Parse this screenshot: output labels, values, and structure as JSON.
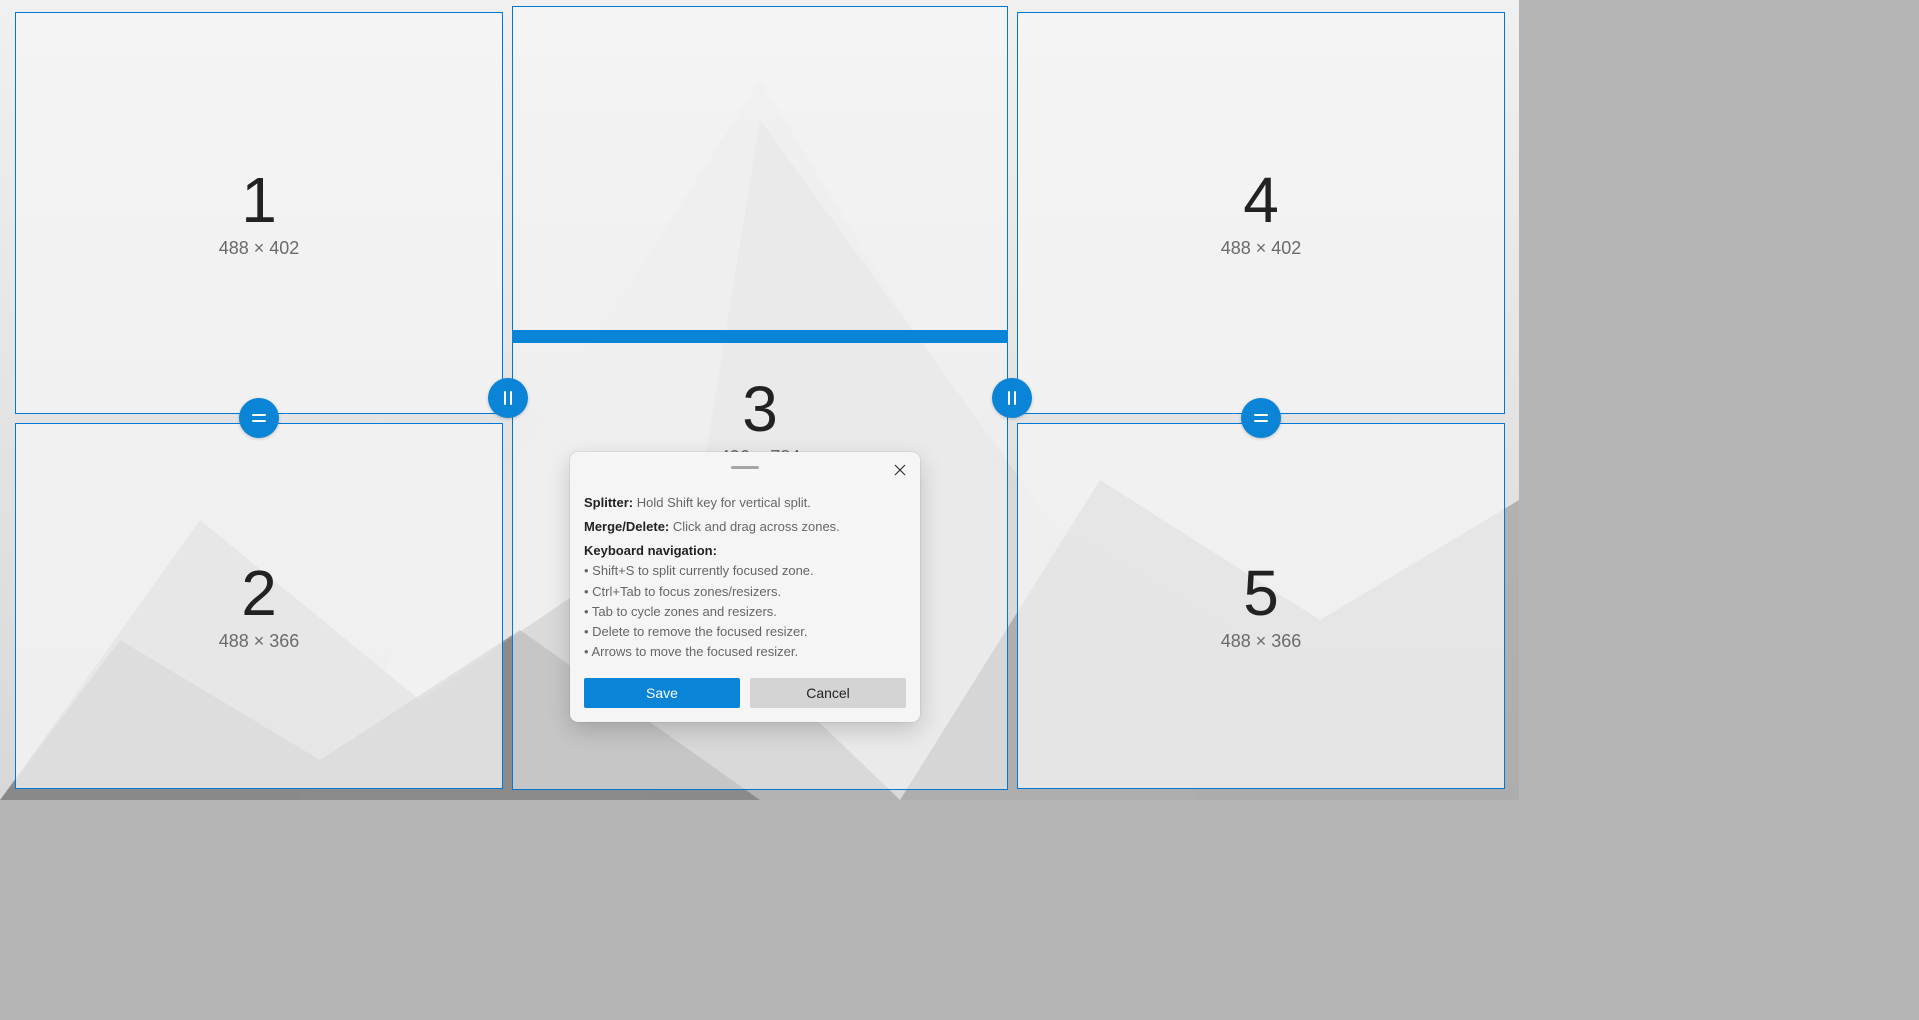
{
  "zones": [
    {
      "label": "1",
      "dim": "488 × 402"
    },
    {
      "label": "2",
      "dim": "488 × 366"
    },
    {
      "label": "3",
      "dim": "496 × 784"
    },
    {
      "label": "4",
      "dim": "488 × 402"
    },
    {
      "label": "5",
      "dim": "488 × 366"
    }
  ],
  "tooltip": {
    "splitter_label": "Splitter:",
    "splitter_text": "Hold Shift key for vertical split.",
    "merge_label": "Merge/Delete:",
    "merge_text": "Click and drag across zones.",
    "nav_label": "Keyboard navigation:",
    "nav_items": [
      "• Shift+S to split currently focused zone.",
      "• Ctrl+Tab to focus zones/resizers.",
      "• Tab to cycle zones and resizers.",
      "• Delete to remove the focused resizer.",
      "• Arrows to move the focused resizer."
    ],
    "save": "Save",
    "cancel": "Cancel"
  },
  "colors": {
    "accent": "#0a84d7"
  }
}
